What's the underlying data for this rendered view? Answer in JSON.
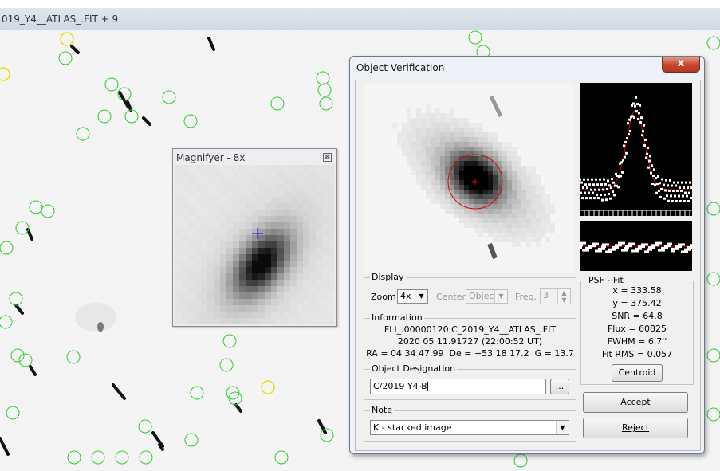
{
  "main_window": {
    "title": "019_Y4__ATLAS_.FIT + 9"
  },
  "magnifier": {
    "title": "Magnifyer - 8x",
    "close_glyph": "⊠"
  },
  "dialog": {
    "title": "Object Verification",
    "close_glyph": "x",
    "display": {
      "legend": "Display",
      "zoom_label": "Zoom",
      "zoom_value": "4x",
      "center_label": "Center",
      "center_value": "Object",
      "freq_label": "Freq.",
      "freq_value": "3"
    },
    "information": {
      "legend": "Information",
      "filename": "FLI_.00000120.C_2019_Y4__ATLAS_.FIT",
      "datetime": "2020 05 11.91727 (22:00:52 UT)",
      "coords": "RA = 04 34 47.99  De = +53 18 17.2  G = 13.7"
    },
    "object_designation": {
      "legend": "Object Designation",
      "value": "C/2019 Y4-B",
      "browse_label": "..."
    },
    "note": {
      "legend": "Note",
      "value": "K - stacked image"
    },
    "psf_fit": {
      "legend": "PSF - Fit",
      "x": "x = 333.58",
      "y": "y = 375.42",
      "snr": "SNR = 64.8",
      "flux": "Flux = 60825",
      "fwhm": "FWHM = 6.7''",
      "fit_rms": "Fit RMS = 0.057",
      "centroid_label": "Centroid"
    },
    "accept_label": "Accept",
    "reject_label": "Reject"
  },
  "colors": {
    "marker_green": "#2ecc2e",
    "marker_yellow": "#e8e000",
    "accent_red": "#e00000",
    "plus_blue": "#1a1aff"
  }
}
